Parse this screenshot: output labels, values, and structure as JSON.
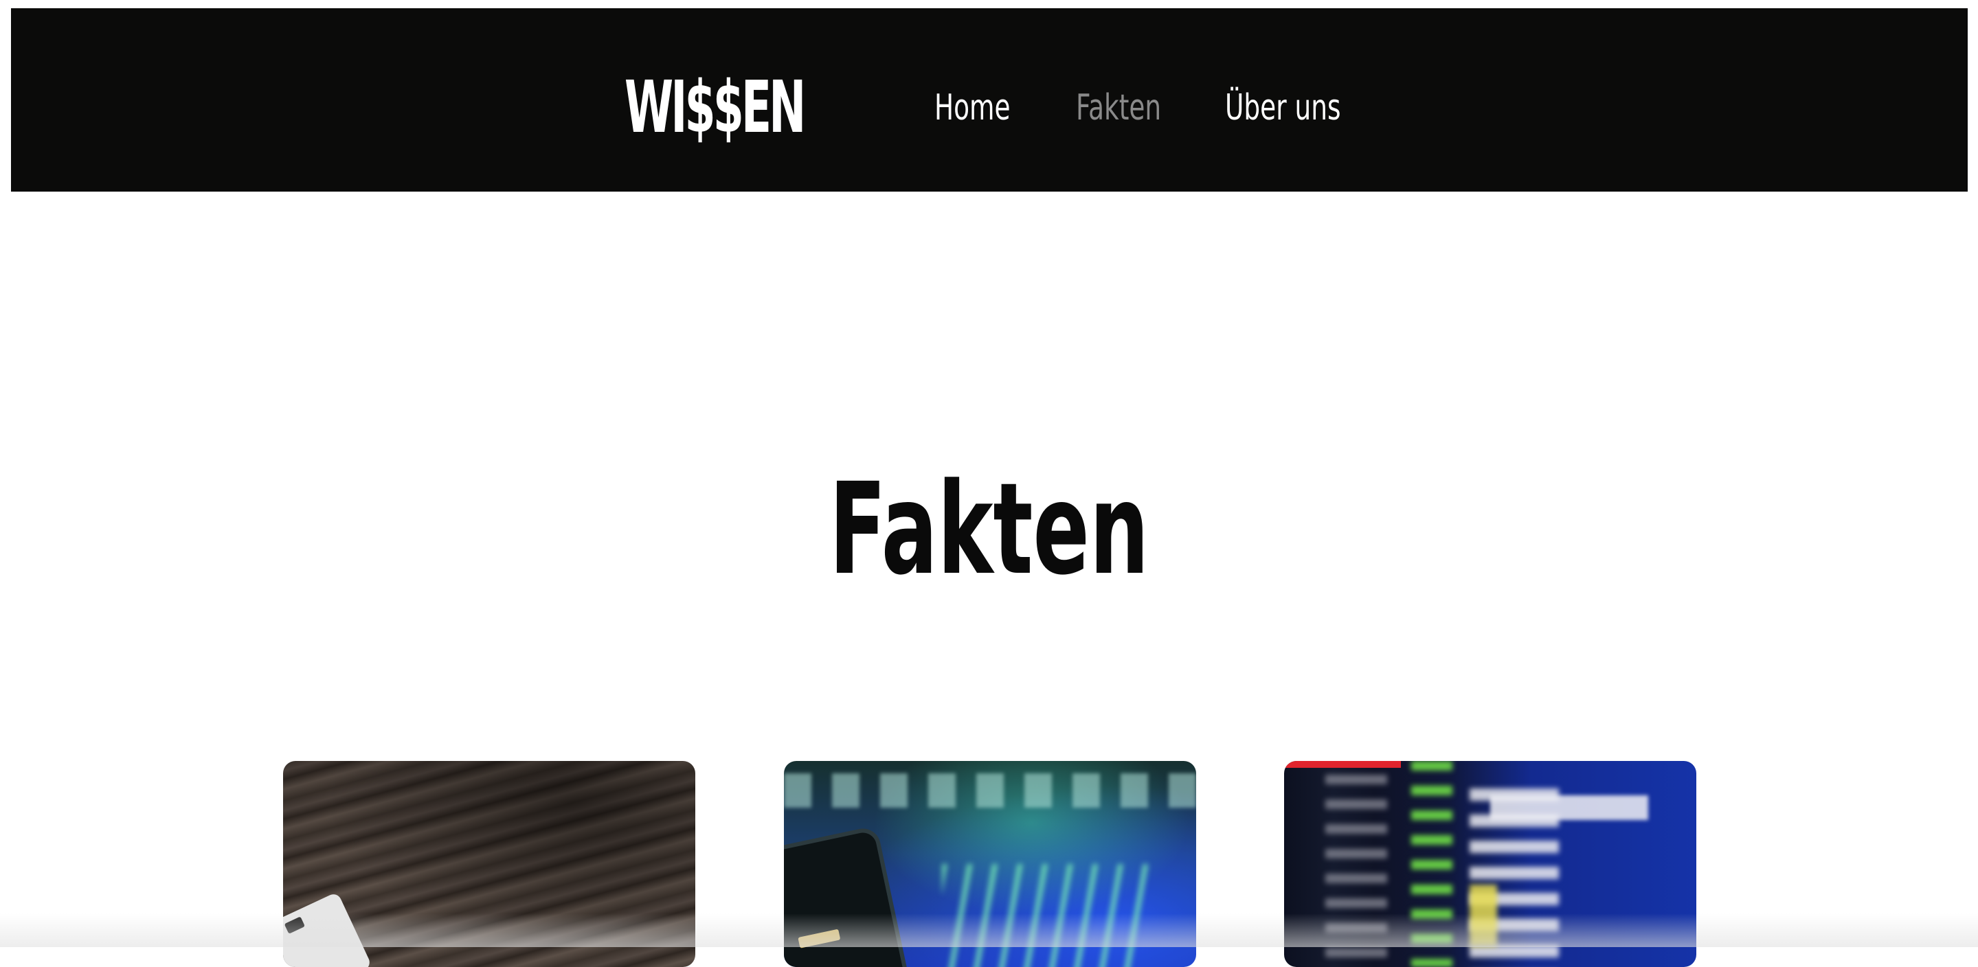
{
  "header": {
    "logo_text": "WI$$EN",
    "nav": [
      {
        "label": "Home",
        "active": false
      },
      {
        "label": "Fakten",
        "active": true
      },
      {
        "label": "Über uns",
        "active": false
      }
    ],
    "background_color": "#0b0b0a",
    "active_color": "#8a8a8a"
  },
  "main": {
    "title": "Fakten",
    "cards": [
      {
        "image": "wooden-desk-with-device-photo"
      },
      {
        "image": "phone-and-stock-chart-photo"
      },
      {
        "image": "stock-ticker-board-photo"
      }
    ]
  }
}
